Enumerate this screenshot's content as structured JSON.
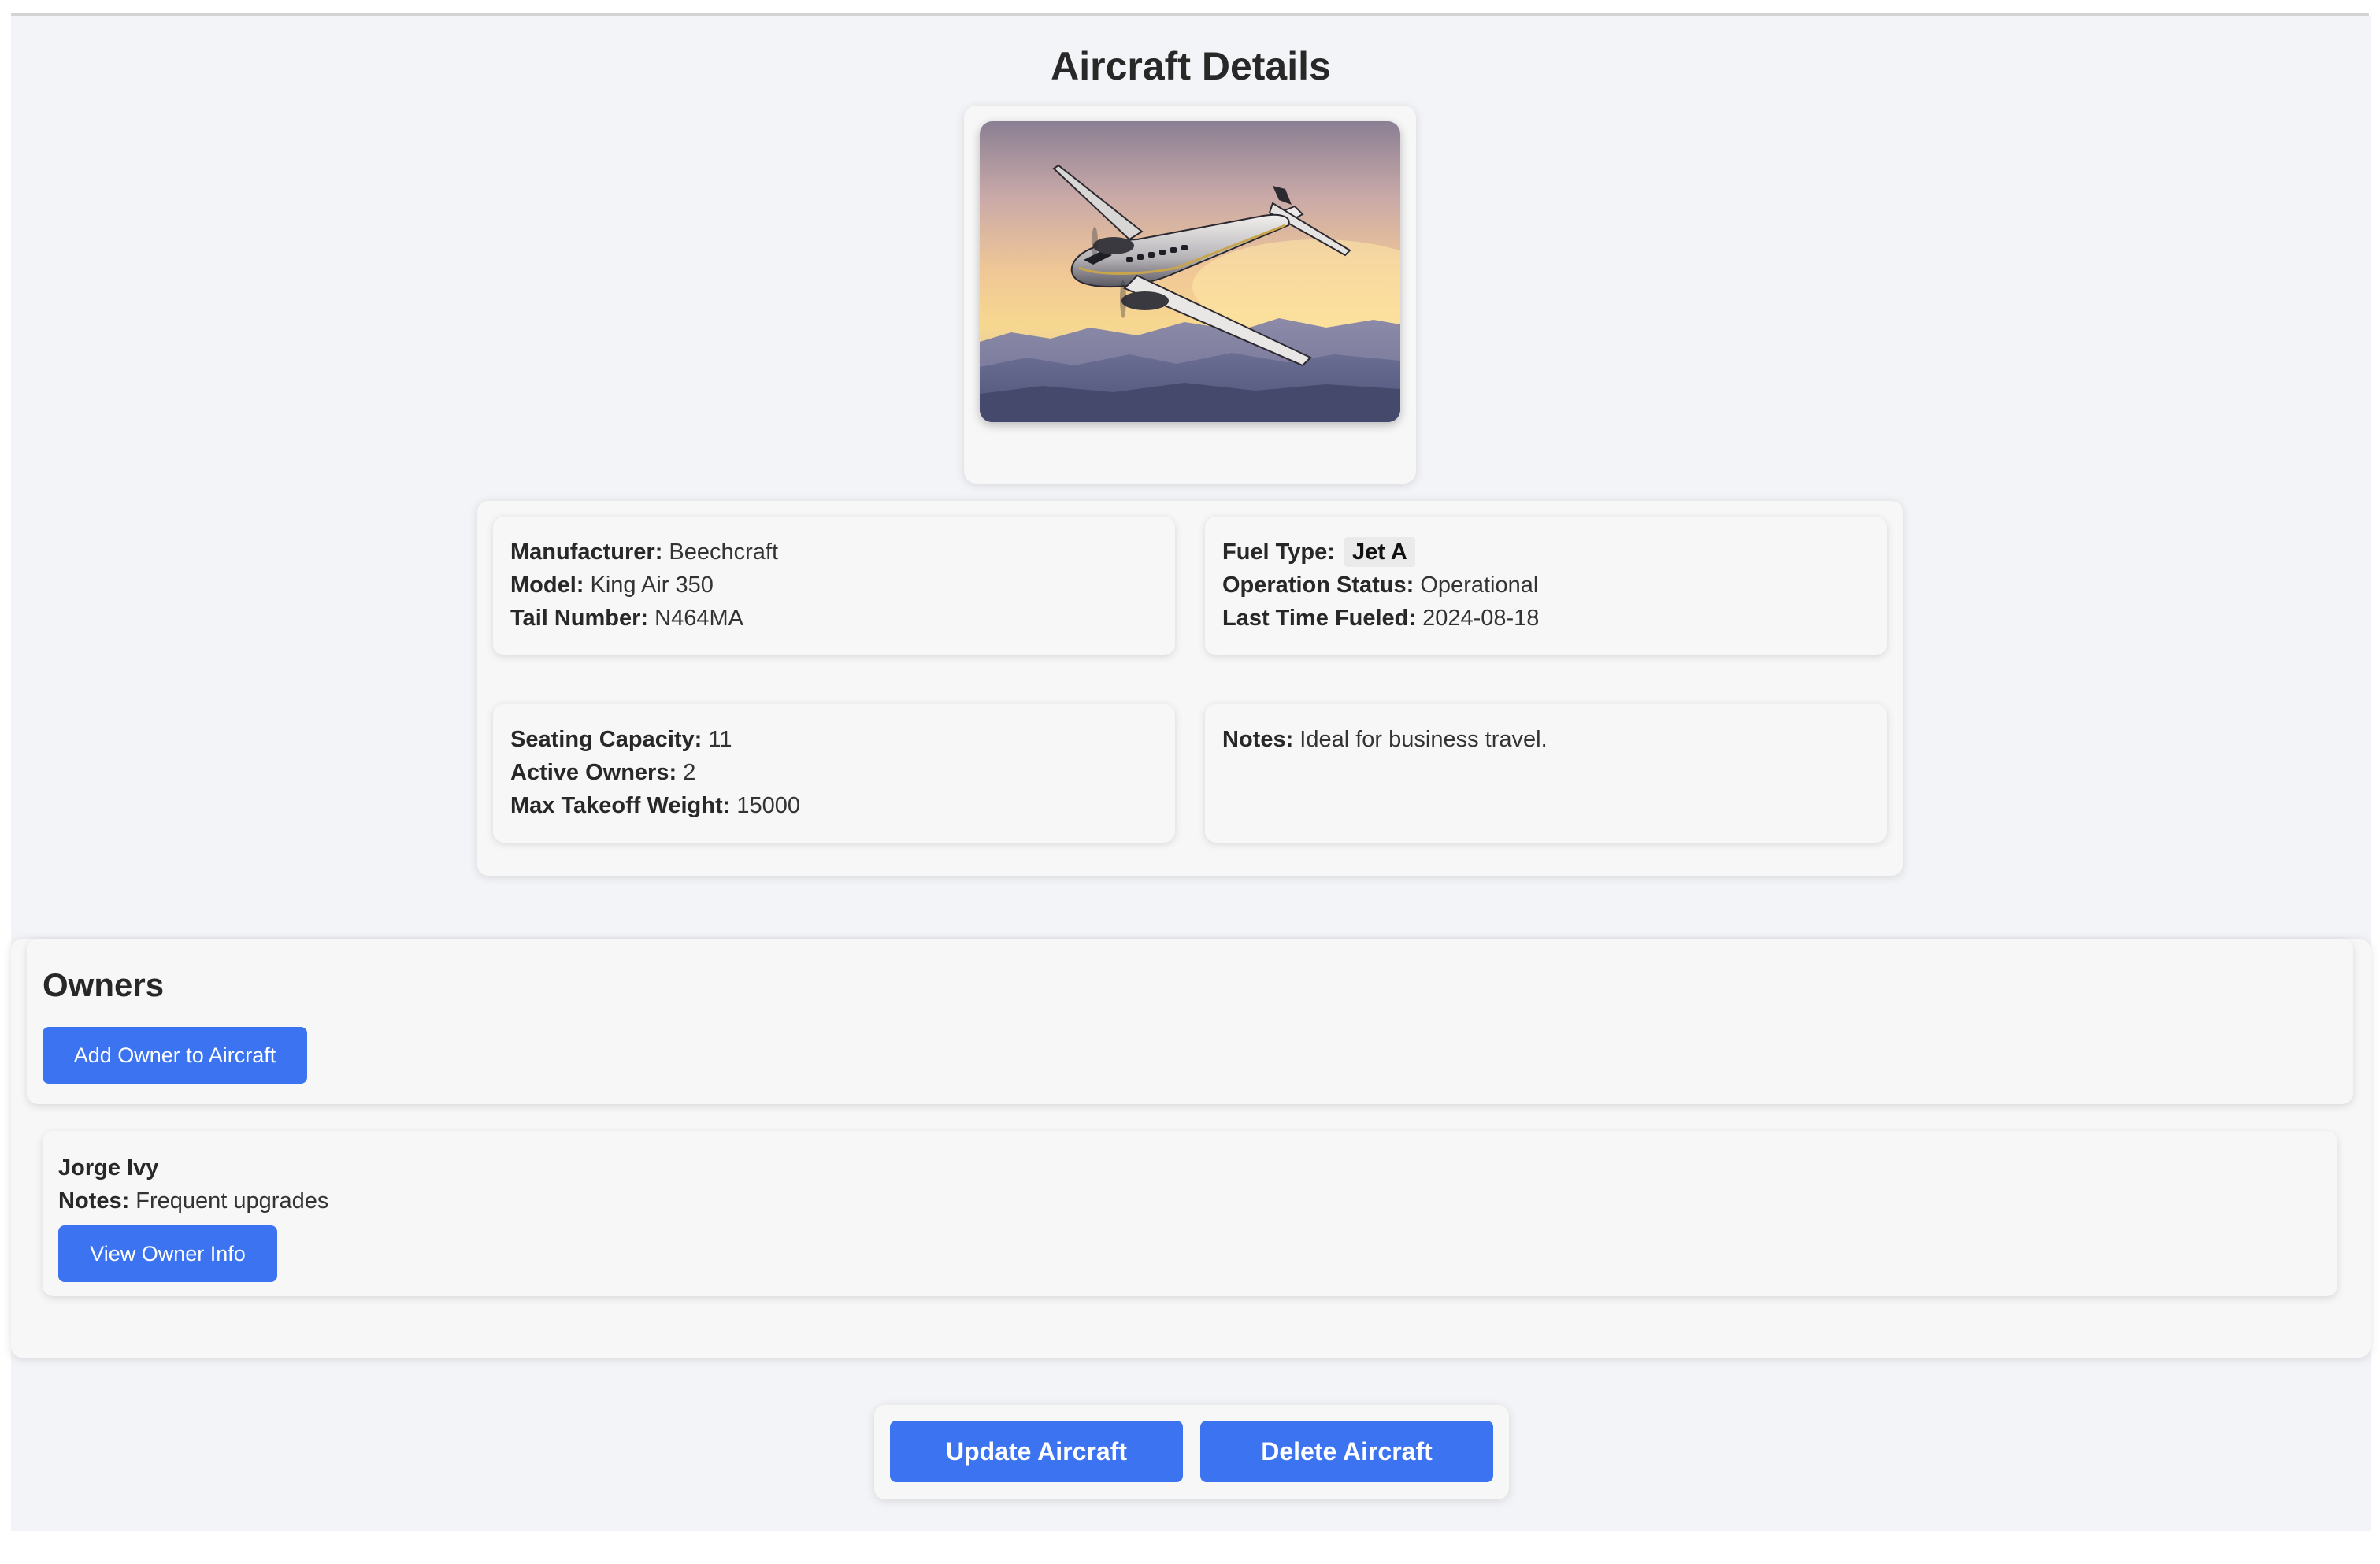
{
  "page": {
    "title": "Aircraft Details"
  },
  "aircraft": {
    "image_alt": "King Air 350 in flight at sunset",
    "manufacturer": {
      "label": "Manufacturer:",
      "value": "Beechcraft"
    },
    "model": {
      "label": "Model:",
      "value": "King Air 350"
    },
    "tail_number": {
      "label": "Tail Number:",
      "value": "N464MA"
    },
    "fuel_type": {
      "label": "Fuel Type:",
      "value": "Jet A"
    },
    "operation_status": {
      "label": "Operation Status:",
      "value": "Operational"
    },
    "last_time_fueled": {
      "label": "Last Time Fueled:",
      "value": "2024-08-18"
    },
    "seating_capacity": {
      "label": "Seating Capacity:",
      "value": "11"
    },
    "active_owners": {
      "label": "Active Owners:",
      "value": "2"
    },
    "max_takeoff_weight": {
      "label": "Max Takeoff Weight:",
      "value": "15000"
    },
    "notes": {
      "label": "Notes:",
      "value": "Ideal for business travel."
    }
  },
  "owners": {
    "title": "Owners",
    "add_button": "Add Owner to Aircraft",
    "items": [
      {
        "name": "Jorge Ivy",
        "notes_label": "Notes:",
        "notes": "Frequent upgrades",
        "view_button": "View Owner Info"
      }
    ]
  },
  "actions": {
    "update_label": "Update Aircraft",
    "delete_label": "Delete Aircraft"
  },
  "colors": {
    "accent": "#3b73f0",
    "page_bg": "#f3f4f7",
    "card_bg": "#f7f7f7"
  }
}
